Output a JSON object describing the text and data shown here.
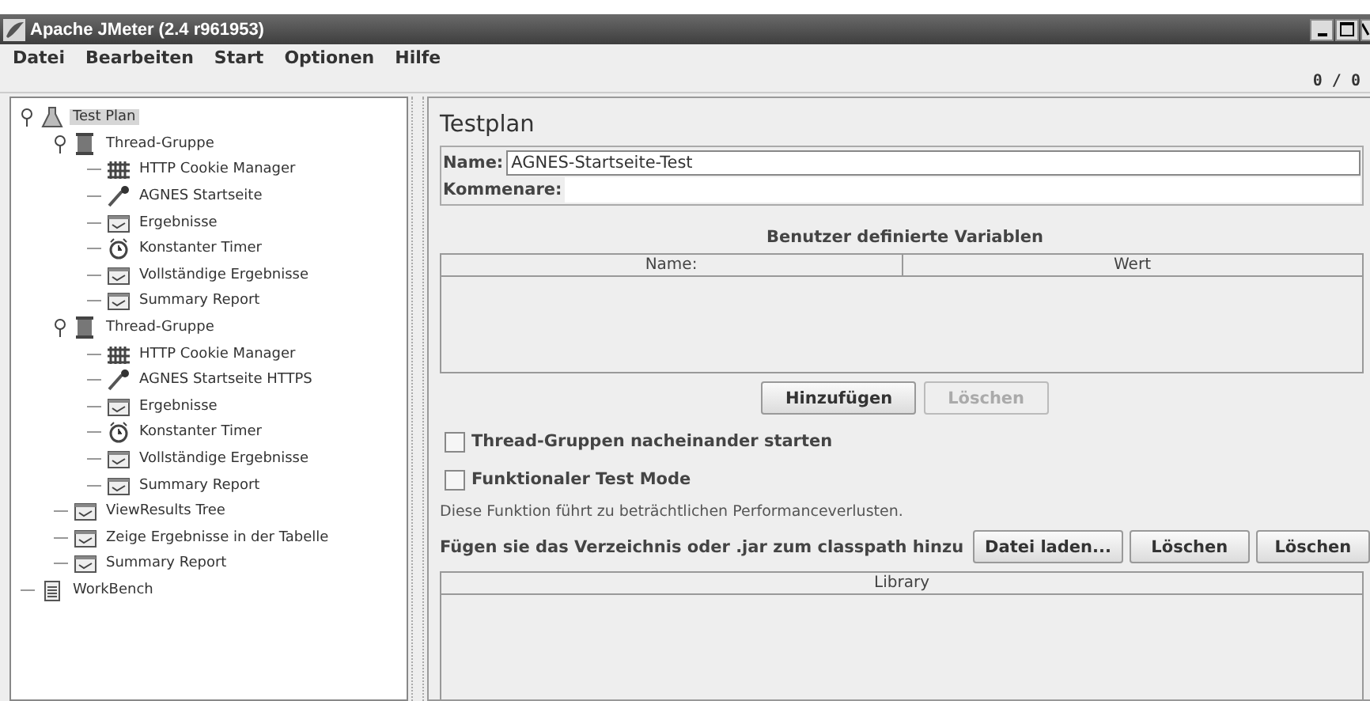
{
  "window": {
    "title": "Apache JMeter (2.4 r961953)"
  },
  "menu": [
    "Datei",
    "Bearbeiten",
    "Start",
    "Optionen",
    "Hilfe"
  ],
  "toolbar": {
    "counter": "0 / 0"
  },
  "tree": [
    {
      "label": "Test Plan",
      "kind": "testplan",
      "selected": true,
      "expanded": true,
      "children": [
        {
          "label": "Thread-Gruppe",
          "kind": "threadgroup",
          "selected": false,
          "expanded": true,
          "children": [
            {
              "label": "HTTP Cookie Manager",
              "kind": "config",
              "selected": false
            },
            {
              "label": "AGNES Startseite",
              "kind": "sampler",
              "selected": false
            },
            {
              "label": "Ergebnisse",
              "kind": "listener",
              "selected": false
            },
            {
              "label": "Konstanter Timer",
              "kind": "timer",
              "selected": false
            },
            {
              "label": "Vollständige Ergebnisse",
              "kind": "listener",
              "selected": false
            },
            {
              "label": "Summary Report",
              "kind": "listener",
              "selected": false
            }
          ]
        },
        {
          "label": "Thread-Gruppe",
          "kind": "threadgroup",
          "selected": false,
          "expanded": true,
          "children": [
            {
              "label": "HTTP Cookie Manager",
              "kind": "config",
              "selected": false
            },
            {
              "label": "AGNES Startseite HTTPS",
              "kind": "sampler",
              "selected": false
            },
            {
              "label": "Ergebnisse",
              "kind": "listener",
              "selected": false
            },
            {
              "label": "Konstanter Timer",
              "kind": "timer",
              "selected": false
            },
            {
              "label": "Vollständige Ergebnisse",
              "kind": "listener",
              "selected": false
            },
            {
              "label": "Summary Report",
              "kind": "listener",
              "selected": false
            }
          ]
        },
        {
          "label": "ViewResults Tree",
          "kind": "listener",
          "selected": false
        },
        {
          "label": "Zeige Ergebnisse in der Tabelle",
          "kind": "listener",
          "selected": false
        },
        {
          "label": "Summary Report",
          "kind": "listener",
          "selected": false
        }
      ]
    },
    {
      "label": "WorkBench",
      "kind": "workbench",
      "selected": false
    }
  ],
  "panel": {
    "title": "Testplan",
    "name_field": {
      "label": "Name:",
      "value": "AGNES-Startseite-Test"
    },
    "comment_field": {
      "label": "Kommenare:"
    },
    "variables": {
      "title": "Benutzer definierte Variablen",
      "columns": [
        "Name:",
        "Wert"
      ]
    },
    "variable_buttons": [
      {
        "label": "Hinzufügen",
        "disabled": false
      },
      {
        "label": "Löschen",
        "disabled": true
      }
    ],
    "checkboxes": [
      {
        "label": "Thread-Gruppen nacheinander starten",
        "checked": false
      },
      {
        "label": "Funktionaler Test Mode",
        "checked": false
      }
    ],
    "note": "Diese Funktion führt zu beträchtlichen Performanceverlusten.",
    "classpath": {
      "label": "Fügen sie das Verzeichnis oder .jar zum classpath hinzu",
      "buttons": [
        {
          "label": "Datei laden...",
          "disabled": false
        },
        {
          "label": "Löschen",
          "disabled": false
        },
        {
          "label": "Löschen",
          "disabled": false
        }
      ]
    },
    "library": {
      "columns": [
        "Library"
      ]
    }
  }
}
